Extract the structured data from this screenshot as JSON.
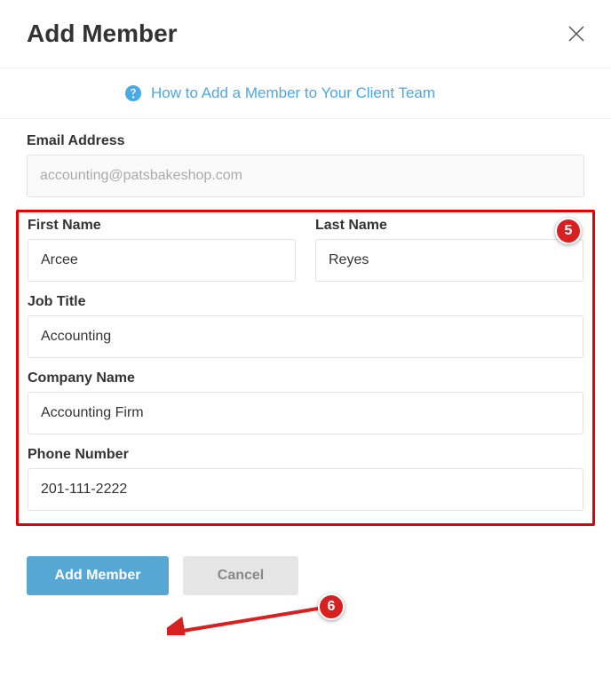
{
  "modal": {
    "title": "Add Member",
    "help_link": "How to Add a Member to Your Client Team"
  },
  "form": {
    "email": {
      "label": "Email Address",
      "value": "accounting@patsbakeshop.com"
    },
    "first_name": {
      "label": "First Name",
      "value": "Arcee"
    },
    "last_name": {
      "label": "Last Name",
      "value": "Reyes"
    },
    "job_title": {
      "label": "Job Title",
      "value": "Accounting"
    },
    "company": {
      "label": "Company Name",
      "value": "Accounting Firm"
    },
    "phone": {
      "label": "Phone Number",
      "value": "201-111-2222"
    }
  },
  "buttons": {
    "submit": "Add Member",
    "cancel": "Cancel"
  },
  "callouts": {
    "five": "5",
    "six": "6"
  }
}
